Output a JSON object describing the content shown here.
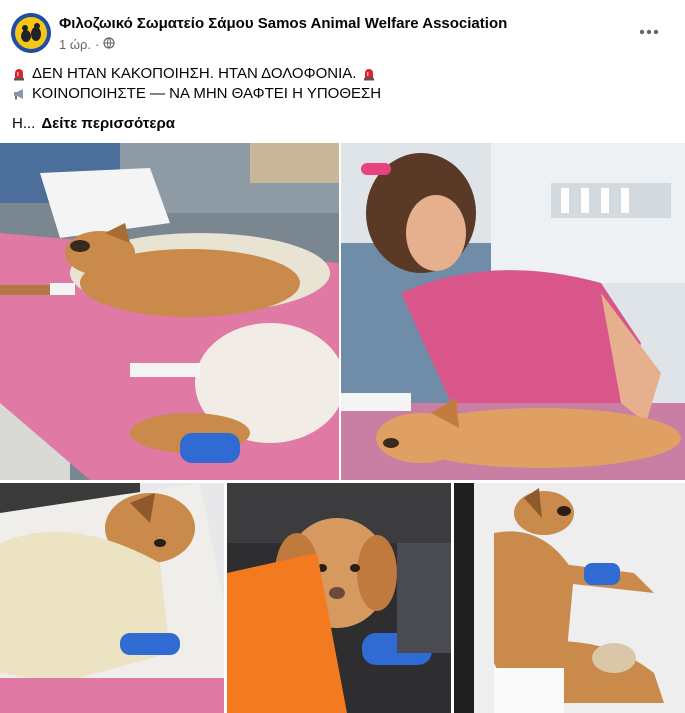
{
  "post": {
    "author": "Φιλοζωικό Σωματείο Σάμου Samos Animal Welfare Association",
    "time": "1 ώρ.",
    "separator": "·",
    "audience_icon": "globe-icon",
    "more_icon": "more-options-icon",
    "text": {
      "line1": "ΔΕΝ ΗΤΑΝ ΚΑΚΟΠΟΙΗΣΗ. ΗΤΑΝ ΔΟΛΟΦΟΝΙΑ.",
      "line1_icons": [
        "siren-icon",
        "siren-icon"
      ],
      "line2": "ΚΟΙΝΟΠΟΙΗΣΤΕ — ΝΑ ΜΗΝ ΘΑΦΤΕΙ Η ΥΠΟΘΕΣΗ",
      "line2_icon": "megaphone-icon",
      "line3_prefix": "Η...",
      "see_more": "Δείτε περισσότερα"
    },
    "photos": [
      {
        "name": "photo-dog-on-vet-table"
      },
      {
        "name": "photo-vet-treating-dog"
      },
      {
        "name": "photo-dog-under-blanket"
      },
      {
        "name": "photo-dog-orange-blanket"
      },
      {
        "name": "photo-dog-lying-bandaged"
      }
    ]
  },
  "colors": {
    "text_primary": "#050505",
    "text_secondary": "#65676b",
    "siren_red": "#d6262c",
    "scrub_pink": "#d9568a",
    "table_pink": "#e07aa5",
    "dog_fur": "#c98a4b",
    "blanket_orange": "#f37a1f",
    "bandage_blue": "#2f6bd3"
  }
}
